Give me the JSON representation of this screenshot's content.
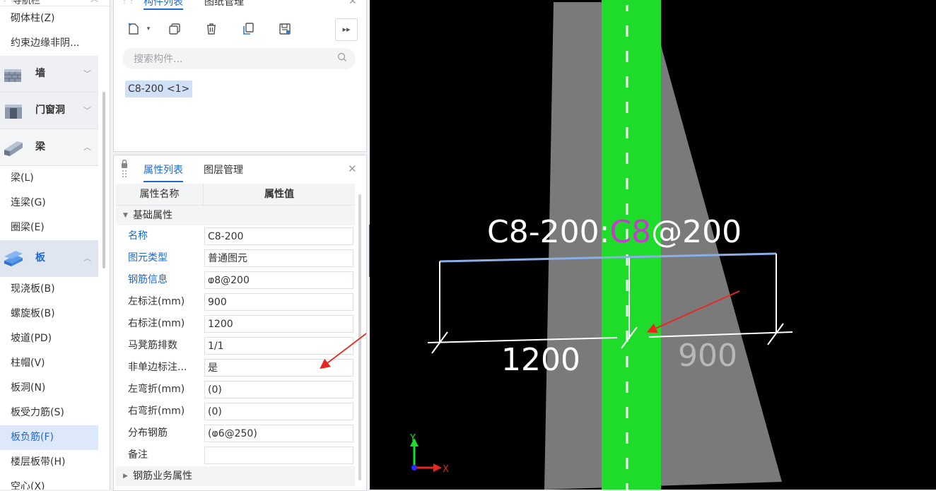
{
  "nav": {
    "header_title": "导航栏",
    "items_top": [
      "砌体柱(Z)",
      "约束边缘非阴..."
    ],
    "categories": [
      {
        "label": "墙",
        "icon": "wall-icon"
      },
      {
        "label": "门窗洞",
        "icon": "door-window-icon"
      },
      {
        "label": "梁",
        "icon": "beam-icon"
      }
    ],
    "beam_items": [
      "梁(L)",
      "连梁(G)",
      "圈梁(E)"
    ],
    "slab_category": {
      "label": "板",
      "icon": "slab-icon"
    },
    "slab_items": [
      "现浇板(B)",
      "螺旋板(B)",
      "坡道(PD)",
      "柱帽(V)",
      "板洞(N)",
      "板受力筋(S)",
      "板负筋(F)",
      "楼层板带(H)"
    ],
    "bottom_partial": "空心(X)",
    "selected": "板负筋(F)"
  },
  "component_panel": {
    "tabs": [
      "构件列表",
      "图纸管理"
    ],
    "active_tab": "构件列表",
    "toolbar": [
      "new-icon",
      "copy-icon",
      "delete-icon",
      "layer-copy-icon",
      "save-icon"
    ],
    "search_placeholder": "搜索构件...",
    "items": [
      "C8-200 <1>"
    ]
  },
  "property_panel": {
    "tabs": [
      "属性列表",
      "图层管理"
    ],
    "active_tab": "属性列表",
    "headers": [
      "属性名称",
      "属性值"
    ],
    "group_basic": "基础属性",
    "rows": [
      {
        "name": "名称",
        "value": "C8-200",
        "highlight": true
      },
      {
        "name": "图元类型",
        "value": "普通图元",
        "highlight": true
      },
      {
        "name": "钢筋信息",
        "value": "ⱷ8@200",
        "highlight": true
      },
      {
        "name": "左标注(mm)",
        "value": "900",
        "highlight": false
      },
      {
        "name": "右标注(mm)",
        "value": "1200",
        "highlight": false
      },
      {
        "name": "马凳筋排数",
        "value": "1/1",
        "highlight": false
      },
      {
        "name": "非单边标注...",
        "value": "是",
        "highlight": false
      },
      {
        "name": "左弯折(mm)",
        "value": "(0)",
        "highlight": false
      },
      {
        "name": "右弯折(mm)",
        "value": "(0)",
        "highlight": false
      },
      {
        "name": "分布钢筋",
        "value": "(ⱷ6@250)",
        "highlight": false
      },
      {
        "name": "备注",
        "value": "",
        "highlight": false
      }
    ],
    "group_rebar": "钢筋业务属性"
  },
  "viewport": {
    "label_prefix": "C8-",
    "label_mid": "200:",
    "label_c8": "C8",
    "label_suffix": "@200",
    "dim_left": "1200",
    "dim_right": "900",
    "axis_y": "Y",
    "axis_x": "X",
    "colors": {
      "background": "#000000",
      "slab": "#7a7a7a",
      "rebar": "#1fdc2a",
      "dimension": "#ffffff",
      "selection_line": "#8aaee6",
      "highlight_c8": "#c83bd0",
      "arrow": "#e8261f"
    }
  }
}
